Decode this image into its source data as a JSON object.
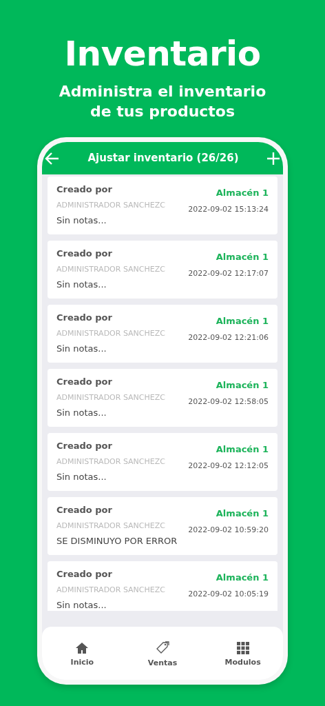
{
  "headline": "Inventario",
  "subheadline": "Administra el inventario de tus productos",
  "app_bar": {
    "title": "Ajustar inventario (26/26)"
  },
  "records": [
    {
      "label": "Creado por",
      "author": "ADMINISTRADOR SANCHEZC",
      "notes": "Sin notas...",
      "warehouse": "Almacén 1",
      "timestamp": "2022-09-02 15:13:24"
    },
    {
      "label": "Creado por",
      "author": "ADMINISTRADOR SANCHEZC",
      "notes": "Sin notas...",
      "warehouse": "Almacén 1",
      "timestamp": "2022-09-02 12:17:07"
    },
    {
      "label": "Creado por",
      "author": "ADMINISTRADOR SANCHEZC",
      "notes": "Sin notas...",
      "warehouse": "Almacén 1",
      "timestamp": "2022-09-02 12:21:06"
    },
    {
      "label": "Creado por",
      "author": "ADMINISTRADOR SANCHEZC",
      "notes": "Sin notas...",
      "warehouse": "Almacén 1",
      "timestamp": "2022-09-02 12:58:05"
    },
    {
      "label": "Creado por",
      "author": "ADMINISTRADOR SANCHEZC",
      "notes": "Sin notas...",
      "warehouse": "Almacén 1",
      "timestamp": "2022-09-02 12:12:05"
    },
    {
      "label": "Creado por",
      "author": "ADMINISTRADOR SANCHEZC",
      "notes": "SE DISMINUYO POR ERROR",
      "warehouse": "Almacén 1",
      "timestamp": "2022-09-02 10:59:20"
    },
    {
      "label": "Creado por",
      "author": "ADMINISTRADOR SANCHEZC",
      "notes": "Sin notas...",
      "warehouse": "Almacén 1",
      "timestamp": "2022-09-02 10:05:19"
    }
  ],
  "bottom_nav": [
    {
      "kind": "home",
      "label": "Inicio"
    },
    {
      "kind": "tag",
      "label": "Ventas"
    },
    {
      "kind": "grid",
      "label": "Modulos"
    }
  ]
}
